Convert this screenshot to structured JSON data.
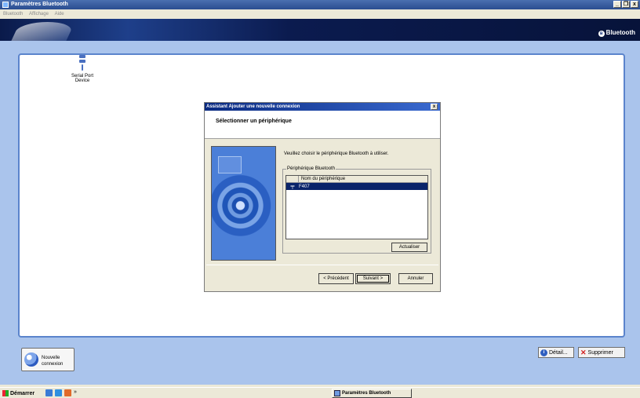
{
  "window": {
    "title": "Paramètres Bluetooth",
    "controls": [
      "_",
      "❐",
      "x"
    ]
  },
  "menu": [
    "Bluetooth",
    "Affichage",
    "Aide"
  ],
  "banner": {
    "brand": "Bluetooth"
  },
  "devices": [
    {
      "line1": "Serial Port",
      "line2": "Device"
    }
  ],
  "bottom": {
    "new_connection_line1": "Nouvelle",
    "new_connection_line2": "connexion",
    "detail_label": "Détail...",
    "delete_label": "Supprimer"
  },
  "dialog": {
    "title": "Assistant Ajouter une nouvelle connexion",
    "close": "x",
    "header": "Sélectionner un périphérique",
    "instruction": "Veuillez choisir le périphérique Bluetooth à utiliser.",
    "group_label": "Périphérique Bluetooth",
    "column_name": "Nom du périphérique",
    "rows": [
      {
        "name": "F407",
        "selected": true
      }
    ],
    "refresh": "Actualiser",
    "prev": "< Précédent",
    "next": "Suivant >",
    "cancel": "Annuler"
  },
  "taskbar": {
    "start": "Démarrer",
    "more": "»",
    "task": "Paramètres Bluetooth"
  },
  "colors": {
    "accent": "#0a246a",
    "panel": "#aac4ec",
    "border": "#5b84cc"
  },
  "icons": {
    "device": "serial-port-icon",
    "new_connection": "bluetooth-wizard-icon",
    "detail": "info-icon",
    "delete": "delete-x-icon"
  }
}
